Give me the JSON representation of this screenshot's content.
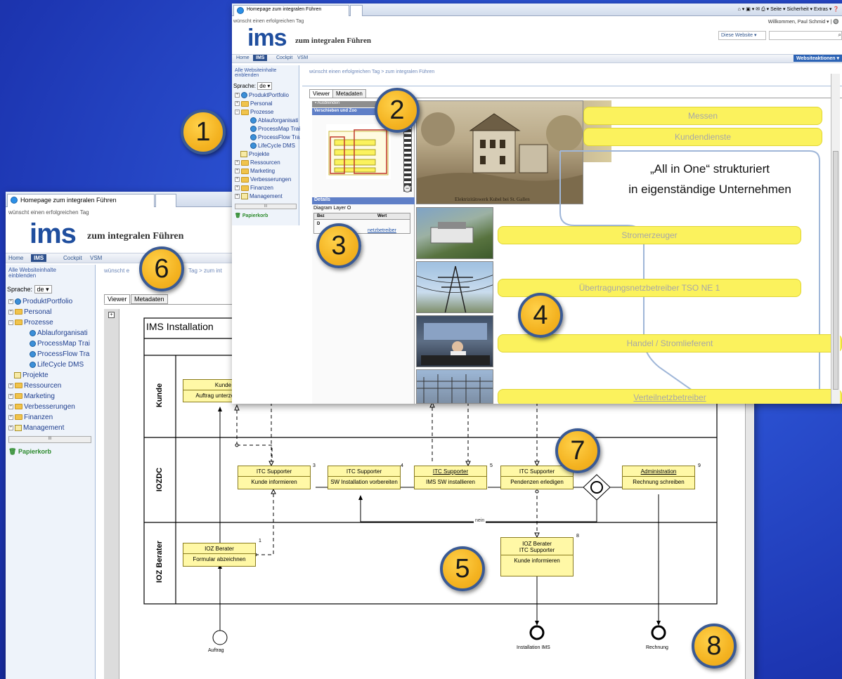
{
  "colors": {
    "background": "#2a4fcf",
    "badge": "#f4b321",
    "badge_border": "#3a5a94",
    "bar_yellow": "#fbf25d",
    "process_box": "#fff8a6",
    "nav_active": "#2c4f8c",
    "recycle_green": "#2c8a2c"
  },
  "badges": [
    "1",
    "2",
    "3",
    "4",
    "5",
    "6",
    "7",
    "8"
  ],
  "back_window": {
    "tab_title": "Homepage zum integralen Führen",
    "greeting": "wünscht einen erfolgreichen Tag",
    "logo": "ims",
    "logo_tagline": "zum integralen Führen",
    "nav": [
      "Home",
      "IMS",
      "Cockpit",
      "VSM"
    ],
    "all_site_content": "Alle Websiteinhalte einblenden",
    "language_label": "Sprache:",
    "language_value": "de",
    "breadcrumb_start": "wünscht e",
    "breadcrumb_end": "Tag > zum int",
    "tabs": [
      "Viewer",
      "Metadaten"
    ],
    "tree": [
      "ProduktPortfolio",
      "Personal",
      "Prozesse",
      "Ablauforganisati",
      "ProcessMap Trai",
      "ProcessFlow Tra",
      "LifeCycle DMS",
      "Projekte",
      "Ressourcen",
      "Marketing",
      "Verbesserungen",
      "Finanzen",
      "Management"
    ],
    "recycle_bin": "Papierkorb",
    "scroll_mid": "III"
  },
  "diagram": {
    "title": "IMS Installation",
    "lanes": [
      "Kunde",
      "IOZDC",
      "IOZ Berater"
    ],
    "kunde_box": {
      "role": "Kunde",
      "task": "Auftrag unterzeichnen"
    },
    "steps": [
      {
        "num": "3",
        "role": "ITC Supporter",
        "task": "Kunde informieren"
      },
      {
        "num": "4",
        "role": "ITC Supporter",
        "task": "SW Installation vorbereiten"
      },
      {
        "num": "5",
        "role": "ITC Supporter",
        "task": "IMS SW installieren"
      },
      {
        "num": "",
        "role": "ITC Supporter",
        "task": "Pendenzen erledigen"
      },
      {
        "num": "9",
        "role": "Administration",
        "task": "Rechnung schreiben"
      }
    ],
    "berater_box": {
      "num": "1",
      "role": "IOZ Berater",
      "task": "Formular abzeichnen"
    },
    "step8": {
      "num": "8",
      "role1": "IOZ Berater",
      "role2": "ITC Supporter",
      "task": "Kunde informieren"
    },
    "loop_label": "nein",
    "events": [
      "Auftrag",
      "Installation IMS",
      "Rechnung"
    ]
  },
  "front_window": {
    "tab_title": "Homepage zum integralen Führen",
    "greeting": "wünscht einen erfolgreichen Tag",
    "logo": "ims",
    "logo_tagline": "zum integralen Führen",
    "toolbar": [
      "Seite ▾",
      "Sicherheit ▾",
      "Extras ▾"
    ],
    "welcome": "Willkommen, Paul Schmid ▾",
    "search_scope": "Diese Website",
    "nav": [
      "Home",
      "IMS",
      "Cockpit",
      "VSM"
    ],
    "site_actions": "Websiteaktionen ▾",
    "all_site_content": "Alle Websiteinhalte einblenden",
    "language_label": "Sprache:",
    "language_value": "de",
    "breadcrumb": "wünscht einen erfolgreichen Tag > zum integralen Führen",
    "tabs": [
      "Viewer",
      "Metadaten"
    ],
    "tree": [
      "ProduktPortfolio",
      "Personal",
      "Prozesse",
      "Ablauforganisati",
      "ProcessMap Trai",
      "ProcessFlow Tra",
      "LifeCycle DMS",
      "Projekte",
      "Ressourcen",
      "Marketing",
      "Verbesserungen",
      "Finanzen",
      "Management"
    ],
    "recycle_bin": "Papierkorb",
    "scroll_mid": "III",
    "panel_hide": "Ausblenden",
    "panel_move": "Verschieben und Zoo",
    "details_header": "Details",
    "diagram_layer": "Diagram Layer O",
    "details_cols": [
      "Bez",
      "Wert"
    ],
    "details_row": "D",
    "details_link": "netzbetreiber",
    "old_photo_caption": "Elektrizitätswerk Kubel bei St. Gallen",
    "headline_line1": "„All in One“ strukturiert",
    "headline_line2": "in eigenständige Unternehmen",
    "bars": [
      "Messen",
      "Kundendienste",
      "Stromerzeuger",
      "Übertragungsnetzbetreiber TSO NE 1",
      "Handel / Stromlieferent",
      "Verteilnetzbetreiber"
    ]
  }
}
